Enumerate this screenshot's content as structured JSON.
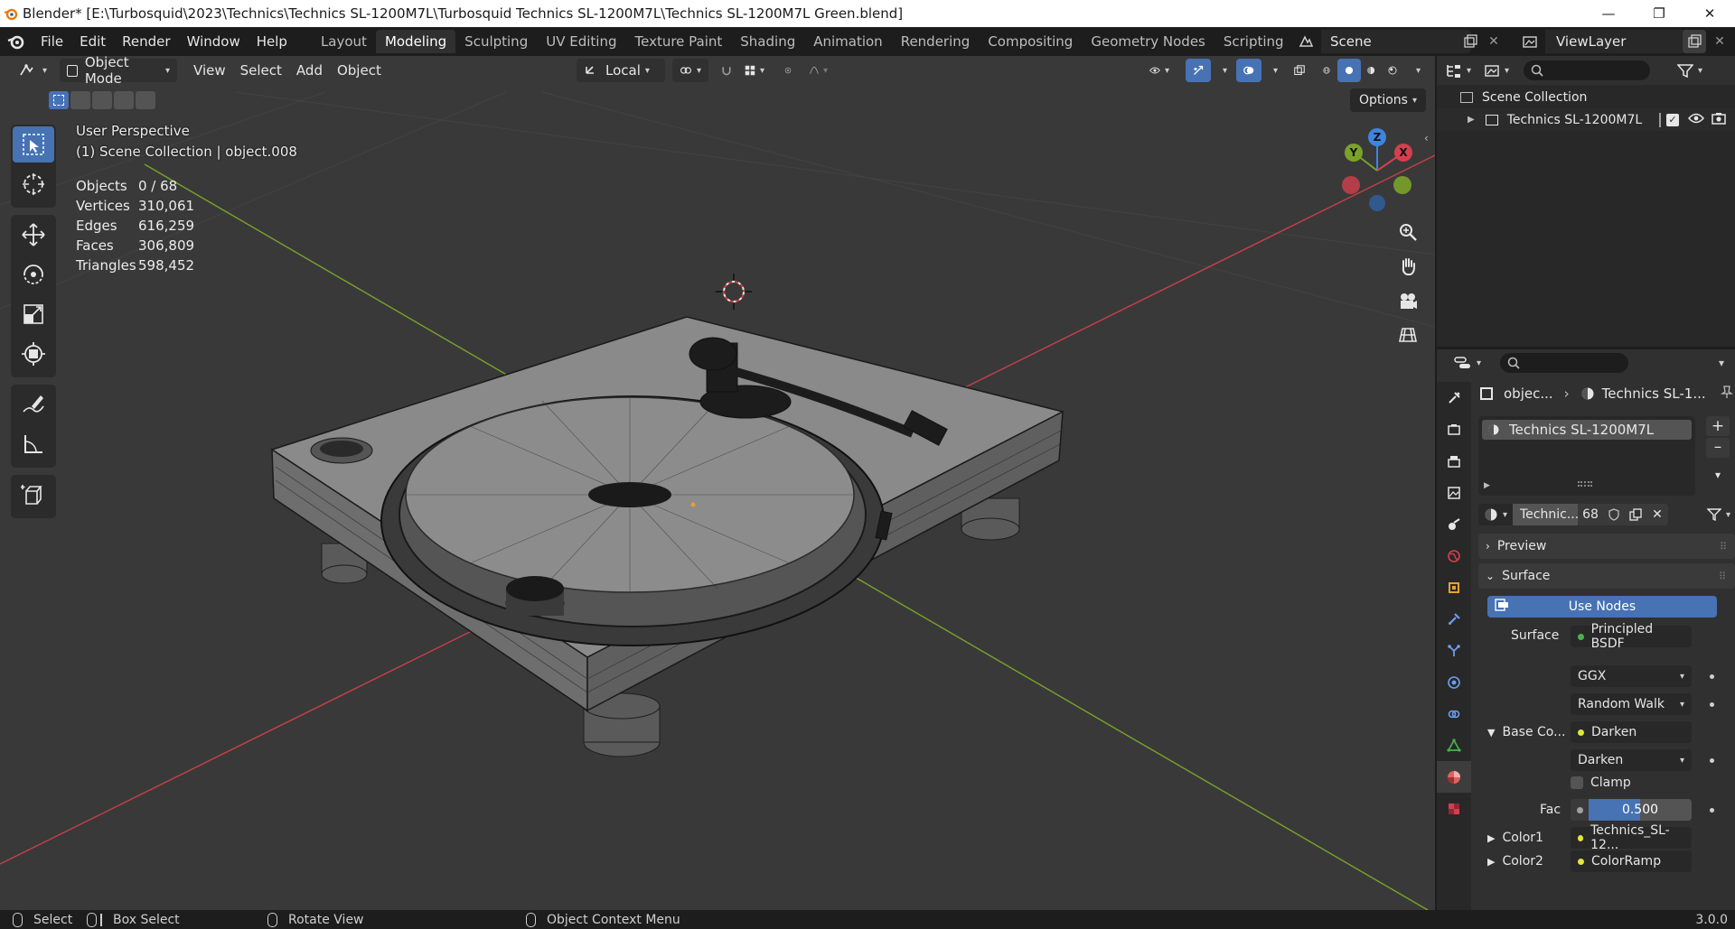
{
  "window": {
    "title": "Blender* [E:\\Turbosquid\\2023\\Technics\\Technics SL-1200M7L\\Turbosquid Technics SL-1200M7L\\Technics SL-1200M7L Green.blend]",
    "minimize": "—",
    "maximize": "❐",
    "close": "✕"
  },
  "menu": [
    "File",
    "Edit",
    "Render",
    "Window",
    "Help"
  ],
  "workspaces": [
    "Layout",
    "Modeling",
    "Sculpting",
    "UV Editing",
    "Texture Paint",
    "Shading",
    "Animation",
    "Rendering",
    "Compositing",
    "Geometry Nodes",
    "Scripting"
  ],
  "active_workspace": "Modeling",
  "scene": {
    "name": "Scene",
    "view_layer": "ViewLayer"
  },
  "viewport_header": {
    "mode": "Object Mode",
    "menus": [
      "View",
      "Select",
      "Add",
      "Object"
    ],
    "orientation": "Local",
    "options": "Options"
  },
  "overlay": {
    "view_name": "User Perspective",
    "collection_info": "(1) Scene Collection | object.008"
  },
  "stats": [
    {
      "label": "Objects",
      "value": "0 / 68"
    },
    {
      "label": "Vertices",
      "value": "310,061"
    },
    {
      "label": "Edges",
      "value": "616,259"
    },
    {
      "label": "Faces",
      "value": "306,809"
    },
    {
      "label": "Triangles",
      "value": "598,452"
    }
  ],
  "gizmo": {
    "x": "X",
    "y": "Y",
    "z": "Z"
  },
  "outliner": {
    "root": "Scene Collection",
    "items": [
      "Technics SL-1200M7L"
    ]
  },
  "properties": {
    "breadcrumb_object": "objec...",
    "breadcrumb_material": "Technics SL-1...",
    "material_slot": "Technics SL-1200M7L",
    "material_name": "Technic...",
    "user_count": "68",
    "panels": {
      "preview": "Preview",
      "surface": "Surface"
    },
    "use_nodes": "Use Nodes",
    "surface_label": "Surface",
    "surface_value": "Principled BSDF",
    "distribution": "GGX",
    "subsurface": "Random Walk",
    "base_color_label": "Base Co...",
    "base_color_value": "Darken",
    "blend_mode": "Darken",
    "clamp_label": "Clamp",
    "fac_label": "Fac",
    "fac_value": "0.500",
    "color1_label": "Color1",
    "color1_value": "Technics_SL-12...",
    "color2_label": "Color2",
    "color2_value": "ColorRamp"
  },
  "statusbar": {
    "select": "Select",
    "box_select": "Box Select",
    "rotate_view": "Rotate View",
    "context_menu": "Object Context Menu",
    "version": "3.0.0"
  },
  "colors": {
    "accent": "#4772b3",
    "x_axis": "#d63e4e",
    "y_axis": "#7aa22a",
    "z_axis": "#3d85e0",
    "viewport_bg": "#393939"
  }
}
